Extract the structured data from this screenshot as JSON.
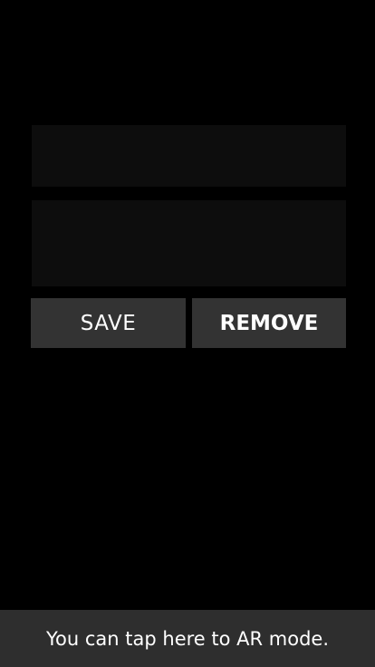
{
  "form": {
    "title_value": "",
    "title_placeholder": "",
    "description_value": "",
    "description_placeholder": ""
  },
  "buttons": {
    "save_label": "SAVE",
    "remove_label": "REMOVE"
  },
  "hint_bar": {
    "text": "You can tap here to AR mode."
  },
  "colors": {
    "background": "#000000",
    "field_background": "#0d0d0d",
    "button_background": "#333333",
    "hint_background": "#2e2e2e",
    "text": "#ffffff"
  }
}
